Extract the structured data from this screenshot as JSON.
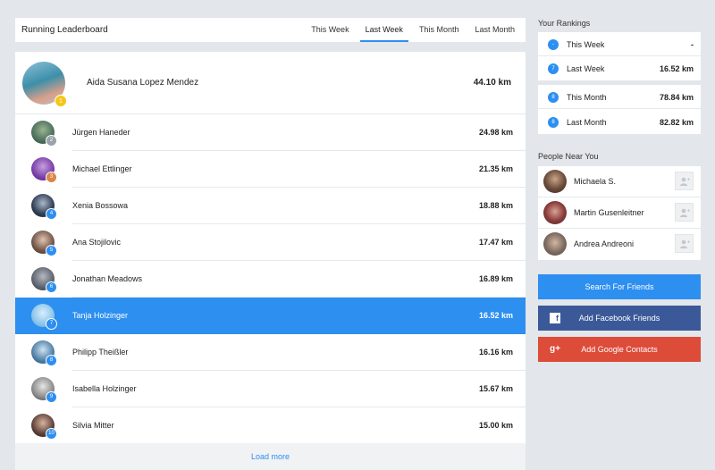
{
  "leaderboard": {
    "title": "Running Leaderboard",
    "tabs": [
      "This Week",
      "Last Week",
      "This Month",
      "Last Month"
    ],
    "active_tab": "Last Week",
    "first": {
      "rank": "1",
      "name": "Aida Susana Lopez Mendez",
      "distance": "44.10 km"
    },
    "rows": [
      {
        "rank": "2",
        "name": "Jürgen Haneder",
        "distance": "24.98 km",
        "badge_color": "#9aa3ab"
      },
      {
        "rank": "3",
        "name": "Michael Ettlinger",
        "distance": "21.35 km",
        "badge_color": "#d9864a"
      },
      {
        "rank": "4",
        "name": "Xenia Bossowa",
        "distance": "18.88 km",
        "badge_color": "#2d8ff0"
      },
      {
        "rank": "5",
        "name": "Ana Stojilovic",
        "distance": "17.47 km",
        "badge_color": "#2d8ff0"
      },
      {
        "rank": "6",
        "name": "Jonathan Meadows",
        "distance": "16.89 km",
        "badge_color": "#2d8ff0"
      },
      {
        "rank": "7",
        "name": "Tanja Holzinger",
        "distance": "16.52 km",
        "badge_color": "#2d8ff0"
      },
      {
        "rank": "8",
        "name": "Philipp Theißler",
        "distance": "16.16 km",
        "badge_color": "#2d8ff0"
      },
      {
        "rank": "9",
        "name": "Isabella Holzinger",
        "distance": "15.67 km",
        "badge_color": "#2d8ff0"
      },
      {
        "rank": "10",
        "name": "Silvia Mitter",
        "distance": "15.00 km",
        "badge_color": "#2d8ff0"
      }
    ],
    "highlighted_rank": "7",
    "load_more": "Load more"
  },
  "rankings": {
    "title": "Your Rankings",
    "items": [
      {
        "rank": "-",
        "label": "This Week",
        "value": "-"
      },
      {
        "rank": "7",
        "label": "Last Week",
        "value": "16.52 km"
      },
      {
        "rank": "8",
        "label": "This Month",
        "value": "78.84 km"
      },
      {
        "rank": "8",
        "label": "Last Month",
        "value": "82.82 km"
      }
    ]
  },
  "people": {
    "title": "People Near You",
    "items": [
      {
        "name": "Michaela S."
      },
      {
        "name": "Martin Gusenleitner"
      },
      {
        "name": "Andrea Andreoni"
      }
    ]
  },
  "buttons": {
    "search_friends": "Search For Friends",
    "facebook": "Add Facebook Friends",
    "google": "Add Google Contacts",
    "google_icon": "g+",
    "facebook_icon": "f"
  },
  "colors": {
    "accent": "#2d8ff0",
    "facebook": "#3b5998",
    "google": "#dd4b39",
    "gold": "#f5c518"
  }
}
